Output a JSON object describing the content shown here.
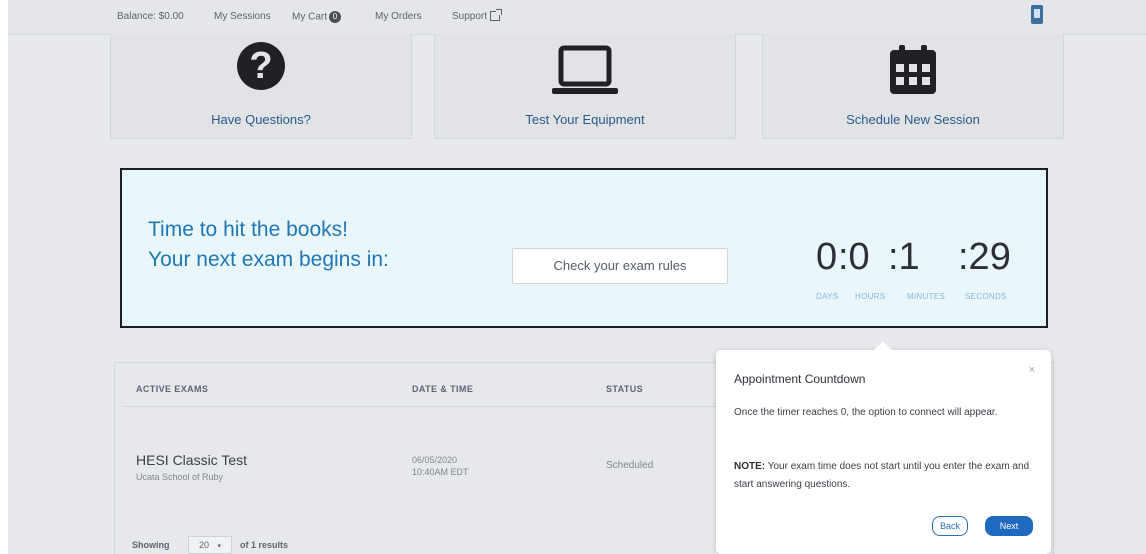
{
  "topnav": {
    "balance": "Balance: $0.00",
    "my_sessions": "My Sessions",
    "my_cart": "My Cart",
    "cart_count": "0",
    "my_orders": "My Orders",
    "support": "Support"
  },
  "tiles": {
    "questions": "Have Questions?",
    "equipment": "Test Your Equipment",
    "schedule": "Schedule New Session"
  },
  "banner": {
    "line1": "Time to hit the books!",
    "line2": "Your next exam begins in:",
    "rules_button": "Check your exam rules",
    "days": "0",
    "hours": ":0",
    "minutes": ":1",
    "seconds": ":29",
    "days_label": "DAYS",
    "hours_label": "HOURS",
    "minutes_label": "MINUTES",
    "seconds_label": "SECONDS"
  },
  "table": {
    "headers": [
      "ACTIVE EXAMS",
      "DATE & TIME",
      "STATUS"
    ],
    "rows": [
      {
        "name": "HESI Classic Test",
        "school": "Ucata School of Ruby",
        "date": "06/05/2020",
        "time": "10:40AM EDT",
        "status": "Scheduled"
      }
    ],
    "showing_label": "Showing",
    "per_page": "20",
    "results_label": "of 1 results"
  },
  "popover": {
    "title": "Appointment Countdown",
    "close": "×",
    "body1": "Once the timer reaches 0, the option to connect will appear.",
    "note_label": "NOTE:",
    "body2": "Your exam time does not start until you enter the exam and start answering questions.",
    "back": "Back",
    "next": "Next"
  },
  "colors": {
    "accent": "#1f78b4",
    "link": "#2a5a8c",
    "primary_button": "#1f69c0",
    "banner_bg": "#e9f6fb"
  }
}
